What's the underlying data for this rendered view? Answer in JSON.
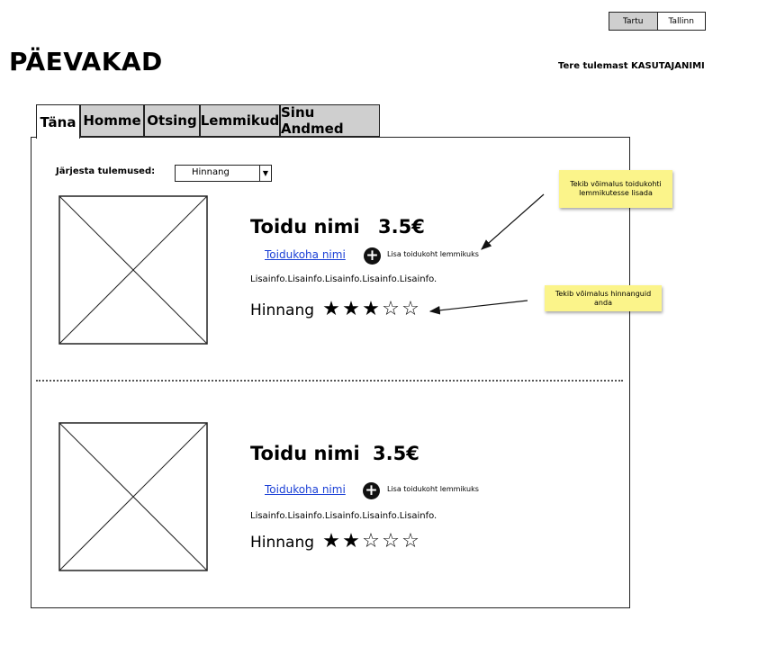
{
  "header": {
    "title": "PÄEVAKAD",
    "welcome": "Tere tulemast KASUTAJANIMI",
    "cities": [
      {
        "label": "Tartu",
        "active": true
      },
      {
        "label": "Tallinn",
        "active": false
      }
    ]
  },
  "tabs": [
    "Täna",
    "Homme",
    "Otsing",
    "Lemmikud",
    "Sinu Andmed"
  ],
  "active_tab": "Täna",
  "sort": {
    "label": "Järjesta tulemused:",
    "value": "Hinnang"
  },
  "items": [
    {
      "food_name": "Toidu nimi",
      "price": "3.5€",
      "place": "Toidukoha nimi",
      "fav_label": "Lisa toidukoht lemmikuks",
      "info": "Lisainfo.Lisainfo.Lisainfo.Lisainfo.Lisainfo.",
      "rating_label": "Hinnang",
      "rating": 3,
      "rating_max": 5
    },
    {
      "food_name": "Toidu nimi",
      "price": "3.5€",
      "place": "Toidukoha nimi",
      "fav_label": "Lisa toidukoht lemmikuks",
      "info": "Lisainfo.Lisainfo.Lisainfo.Lisainfo.Lisainfo.",
      "rating_label": "Hinnang",
      "rating": 2,
      "rating_max": 5
    }
  ],
  "notes": [
    "Tekib võimalus toidukohti lemmikutesse lisada",
    "Tekib võimalus hinnanguid anda"
  ],
  "icons": {
    "placeholder": "image-placeholder-icon",
    "add": "plus-circle-icon",
    "star_filled": "star-filled-icon",
    "star_empty": "star-empty-icon"
  },
  "colors": {
    "tab_inactive": "#cfcfcf",
    "link": "#1a3fd6",
    "sticky_note": "#fbf48a"
  }
}
